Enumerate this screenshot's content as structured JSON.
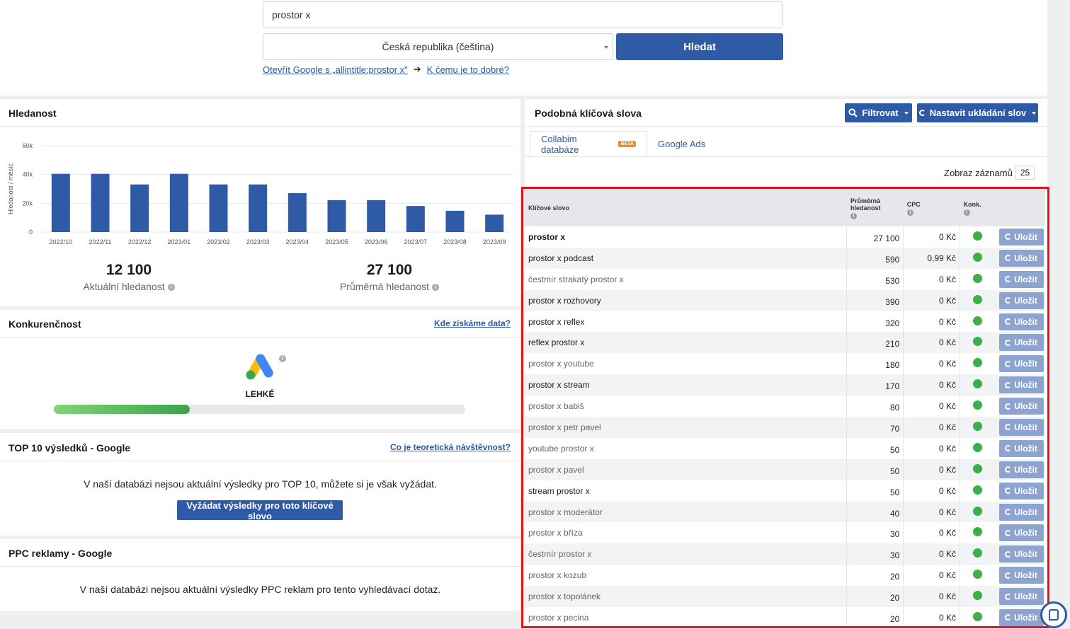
{
  "search": {
    "query": "prostor x",
    "country": "Česká republika (čeština)",
    "button": "Hledat",
    "link_google": "Otevřít Google s „allintitle:prostor x\"",
    "link_why": "K čemu je to dobré?"
  },
  "search_volume": {
    "title": "Hledanost",
    "current_value": "12 100",
    "current_label": "Aktuální hledanost",
    "average_value": "27 100",
    "average_label": "Průměrná hledanost"
  },
  "chart_data": {
    "type": "bar",
    "ylabel": "Hledanost / měsíc",
    "xlabel": "",
    "ylim": [
      0,
      60000
    ],
    "yticks": [
      "0",
      "20k",
      "40k",
      "60k"
    ],
    "categories": [
      "2022/10",
      "2022/11",
      "2022/12",
      "2023/01",
      "2023/02",
      "2023/03",
      "2023/04",
      "2023/05",
      "2023/06",
      "2023/07",
      "2023/08",
      "2023/09"
    ],
    "values": [
      40500,
      40500,
      33100,
      40500,
      33100,
      33100,
      27100,
      22200,
      22200,
      18100,
      14800,
      12100
    ],
    "grid": true,
    "color": "#2f5aa6"
  },
  "competition": {
    "title": "Konkurenčnost",
    "link": "Kde získáme data?",
    "level": "LEHKÉ",
    "level_fraction": 0.33
  },
  "top10": {
    "title": "TOP 10 výsledků - Google",
    "link": "Co je teoretická návštěvnost?",
    "message": "V naší databázi nejsou aktuální výsledky pro TOP 10, můžete si je však vyžádat.",
    "button": "Vyžádat výsledky pro toto klíčové slovo"
  },
  "ppc": {
    "title": "PPC reklamy - Google",
    "message": "V naší databázi nejsou aktuální výsledky PPC reklam pro tento vyhledávací dotaz."
  },
  "similar": {
    "title": "Podobná klíčová slova",
    "filter_button": "Filtrovat",
    "save_settings_button": "Nastavit ukládání slov",
    "tab_collabim": "Collabim databáze",
    "beta": "BETA",
    "tab_google_ads": "Google Ads",
    "records_label": "Zobraz záznamů",
    "records_value": "25",
    "columns": {
      "keyword": "Klíčové slovo",
      "avg_line1": "Průměrná",
      "avg_line2": "hledanost",
      "cpc": "CPC",
      "konk": "Konk."
    },
    "save_label": "Uložit",
    "rows": [
      {
        "kw": "prostor x",
        "avg": "27 100",
        "cpc": "0 Kč",
        "style": "bold"
      },
      {
        "kw": "prostor x podcast",
        "avg": "590",
        "cpc": "0,99 Kč",
        "style": "strong"
      },
      {
        "kw": "čestmír strakatý prostor x",
        "avg": "530",
        "cpc": "0 Kč",
        "style": "light"
      },
      {
        "kw": "prostor x rozhovory",
        "avg": "390",
        "cpc": "0 Kč",
        "style": "strong"
      },
      {
        "kw": "prostor x reflex",
        "avg": "320",
        "cpc": "0 Kč",
        "style": "strong"
      },
      {
        "kw": "reflex prostor x",
        "avg": "210",
        "cpc": "0 Kč",
        "style": "strong"
      },
      {
        "kw": "prostor x youtube",
        "avg": "180",
        "cpc": "0 Kč",
        "style": "light"
      },
      {
        "kw": "prostor x stream",
        "avg": "170",
        "cpc": "0 Kč",
        "style": "strong"
      },
      {
        "kw": "prostor x babiš",
        "avg": "80",
        "cpc": "0 Kč",
        "style": "light"
      },
      {
        "kw": "prostor x petr pavel",
        "avg": "70",
        "cpc": "0 Kč",
        "style": "light"
      },
      {
        "kw": "youtube prostor x",
        "avg": "50",
        "cpc": "0 Kč",
        "style": "light"
      },
      {
        "kw": "prostor x pavel",
        "avg": "50",
        "cpc": "0 Kč",
        "style": "light"
      },
      {
        "kw": "stream prostor x",
        "avg": "50",
        "cpc": "0 Kč",
        "style": "strong"
      },
      {
        "kw": "prostor x moderátor",
        "avg": "40",
        "cpc": "0 Kč",
        "style": "light"
      },
      {
        "kw": "prostor x bříza",
        "avg": "30",
        "cpc": "0 Kč",
        "style": "light"
      },
      {
        "kw": "čestmír prostor x",
        "avg": "30",
        "cpc": "0 Kč",
        "style": "light"
      },
      {
        "kw": "prostor x kozub",
        "avg": "20",
        "cpc": "0 Kč",
        "style": "light"
      },
      {
        "kw": "prostor x topolánek",
        "avg": "20",
        "cpc": "0 Kč",
        "style": "light"
      },
      {
        "kw": "prostor x pecina",
        "avg": "20",
        "cpc": "0 Kč",
        "style": "light"
      }
    ]
  },
  "colors": {
    "primary": "#2f5aa6",
    "competition_green": "#3dae4a",
    "highlight": "#e3141b"
  }
}
